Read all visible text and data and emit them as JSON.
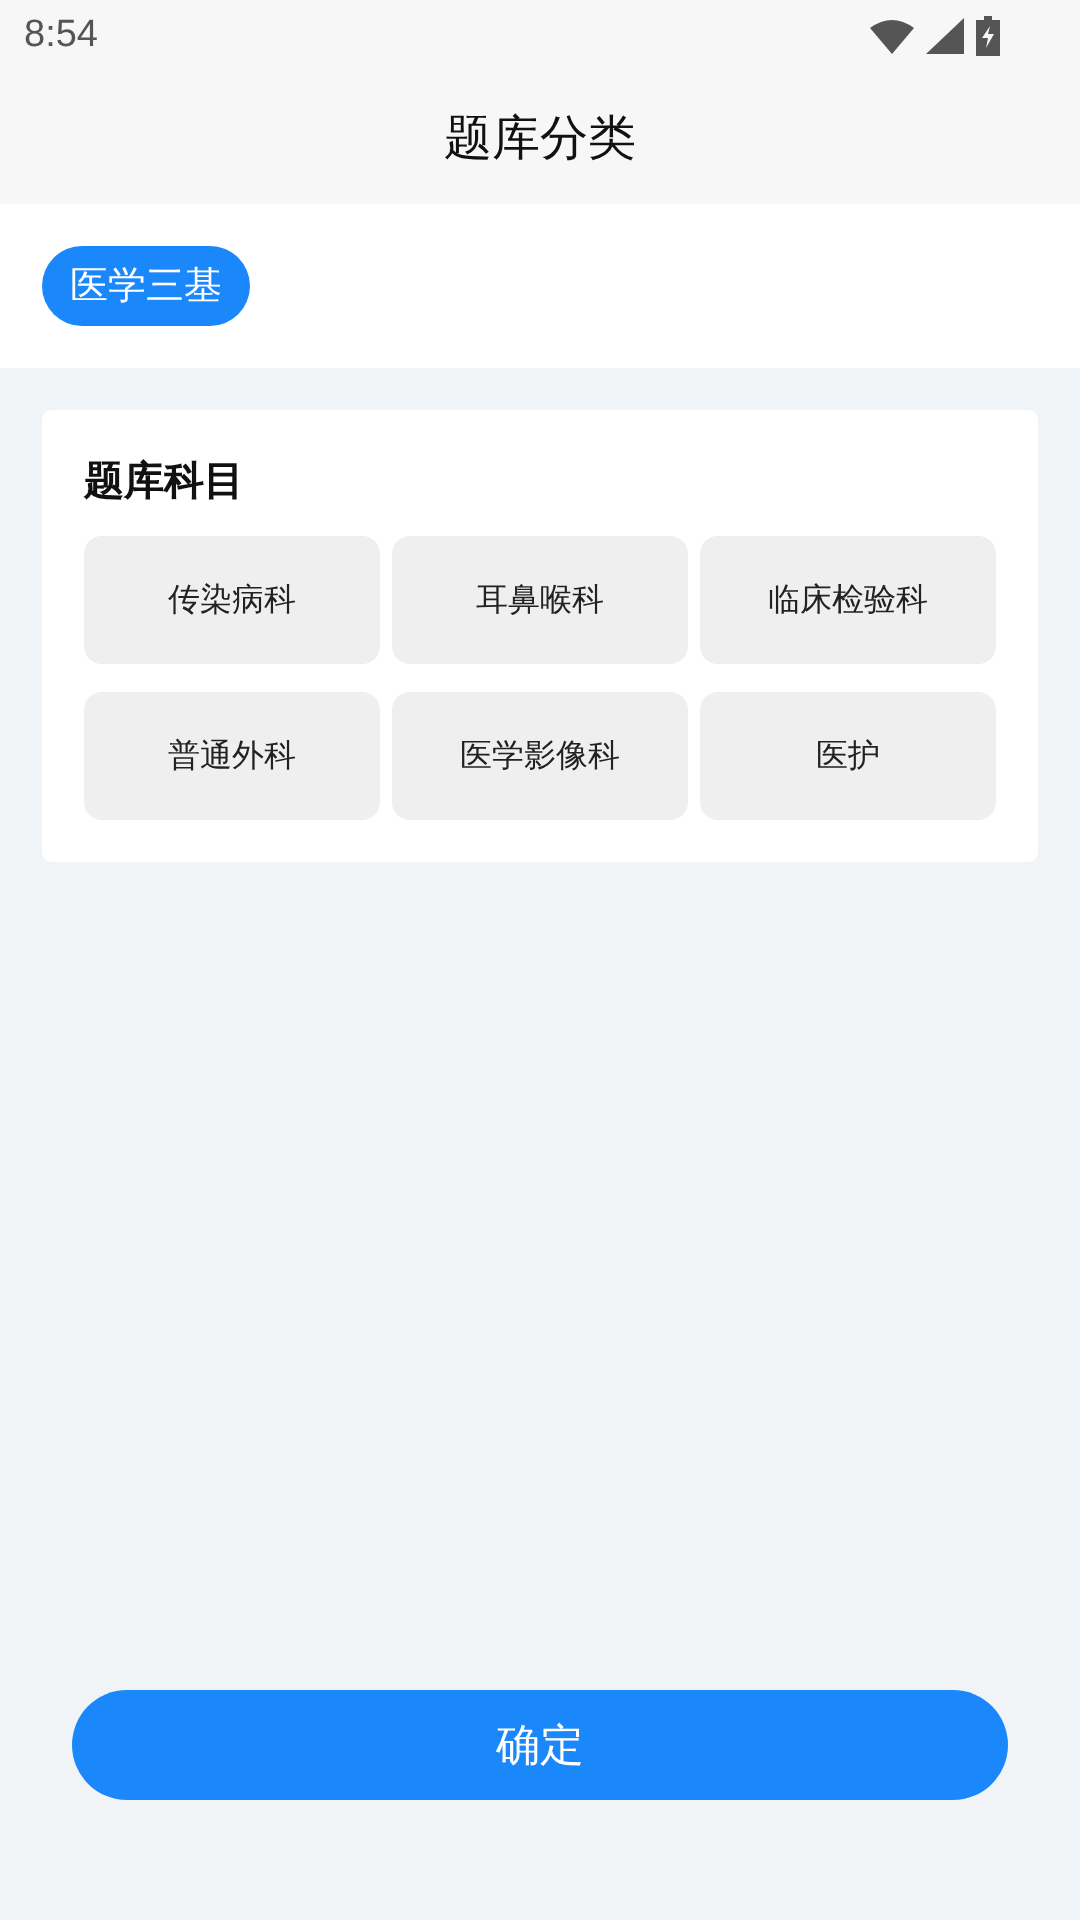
{
  "status_bar": {
    "time": "8:54"
  },
  "header": {
    "title": "题库分类"
  },
  "categories": [
    {
      "label": "医学三基",
      "selected": true
    }
  ],
  "subjects": {
    "title": "题库科目",
    "items": [
      {
        "label": "传染病科"
      },
      {
        "label": "耳鼻喉科"
      },
      {
        "label": "临床检验科"
      },
      {
        "label": "普通外科"
      },
      {
        "label": "医学影像科"
      },
      {
        "label": "医护"
      }
    ]
  },
  "confirm_button": {
    "label": "确定"
  }
}
